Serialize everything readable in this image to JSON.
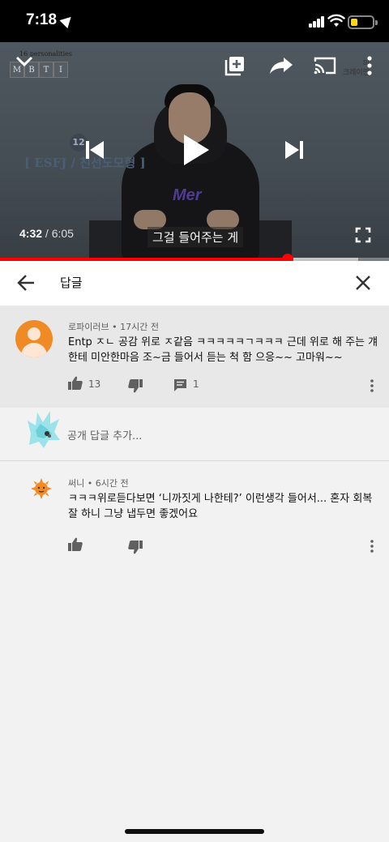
{
  "status_bar": {
    "time": "7:18"
  },
  "player": {
    "mbti_subtitle": "16 personalities",
    "mbti_letters": [
      "M",
      "B",
      "T",
      "I"
    ],
    "badge_number": "12",
    "overlay_title": "[ ESFJ / 친선도모형 ]",
    "corner_text": "미\n크레이만",
    "shirt_text": "Mer",
    "caption": "그걸 들어주는 게",
    "current_time": "4:32",
    "duration": "/ 6:05",
    "progress_fraction": 0.74,
    "buffer_fraction": 0.92
  },
  "reply_panel": {
    "title": "답글"
  },
  "main_comment": {
    "author": "로파이러브",
    "age": "17시간 전",
    "text_line1": "Entp ㅈㄴ 공감 위로 ㅈ같음 ㅋㅋㅋㅋㅋㄱㅋㅋㅋ 근데 위로 해 주는 걔",
    "text_line2": "한테 미안한마음 조~금 들어서 듣는 척 함 으응~~ 고마워~~",
    "likes": "13",
    "replies": "1"
  },
  "add_reply": {
    "placeholder": "공개 답글 추가..."
  },
  "reply_comment": {
    "author": "써니",
    "age": "6시간 전",
    "text_line1": "ㅋㅋㅋ위로듣다보면 ‘니까짓게 나한테?’ 이런생각 들어서... 혼자 회복",
    "text_line2": "잘 하니 그냥 냅두면 좋겠어요"
  },
  "colors": {
    "progress": "#ff0000",
    "main_comment_bg": "#e8e8e8",
    "avatar": "#f08a24"
  }
}
